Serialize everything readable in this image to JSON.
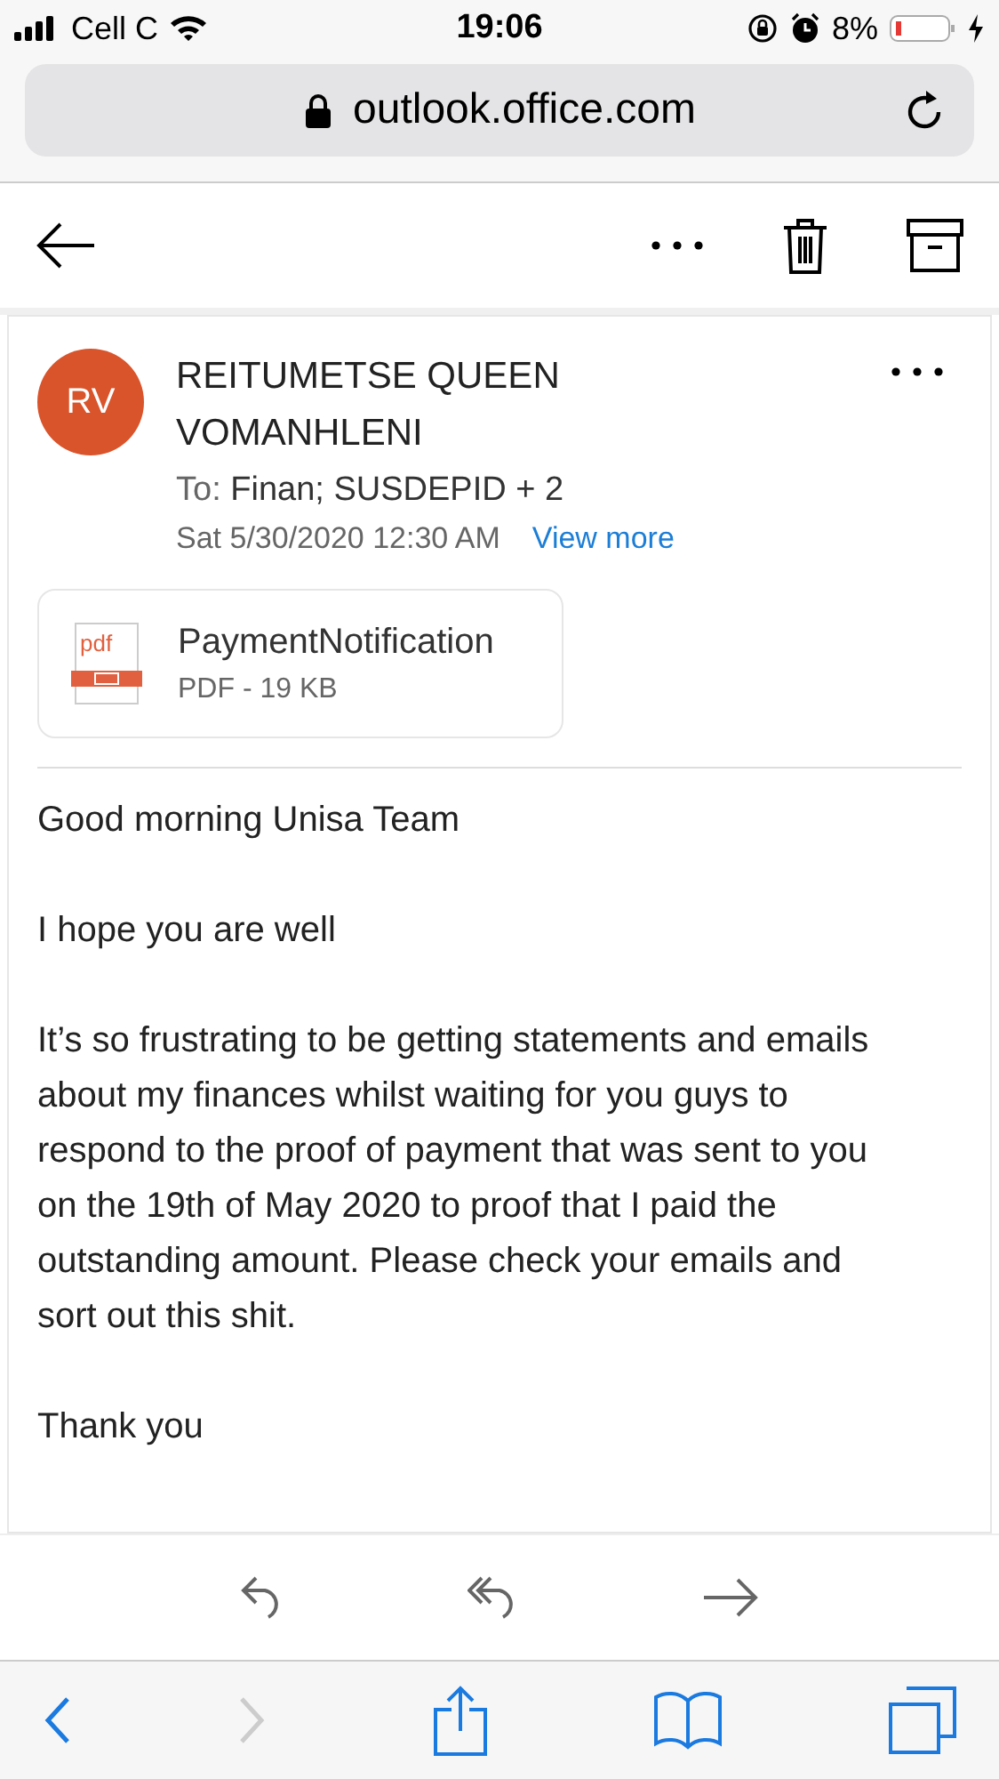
{
  "status_bar": {
    "carrier": "Cell C",
    "time": "19:06",
    "battery": "8%"
  },
  "browser": {
    "url": "outlook.office.com",
    "back_disabled": false,
    "forward_disabled": true
  },
  "message": {
    "avatar_initials": "RV",
    "sender": "REITUMETSE QUEEN VOMANHLENI",
    "to_label": "To:",
    "recipients": "Finan;  SUSDEPID  + 2",
    "date": "Sat 5/30/2020 12:30 AM",
    "view_more": "View more",
    "attachment": {
      "name": "PaymentNotification",
      "meta": "PDF - 19 KB",
      "icon_text": "pdf"
    },
    "body": [
      "Good morning Unisa Team",
      "I hope you are well",
      "It’s so frustrating to be getting statements and emails about my finances whilst waiting for you guys to respond to the proof of payment that was sent to you on the 19th of May 2020 to proof that I paid the outstanding amount. Please check your emails and sort out this shit.",
      "Thank you"
    ]
  }
}
